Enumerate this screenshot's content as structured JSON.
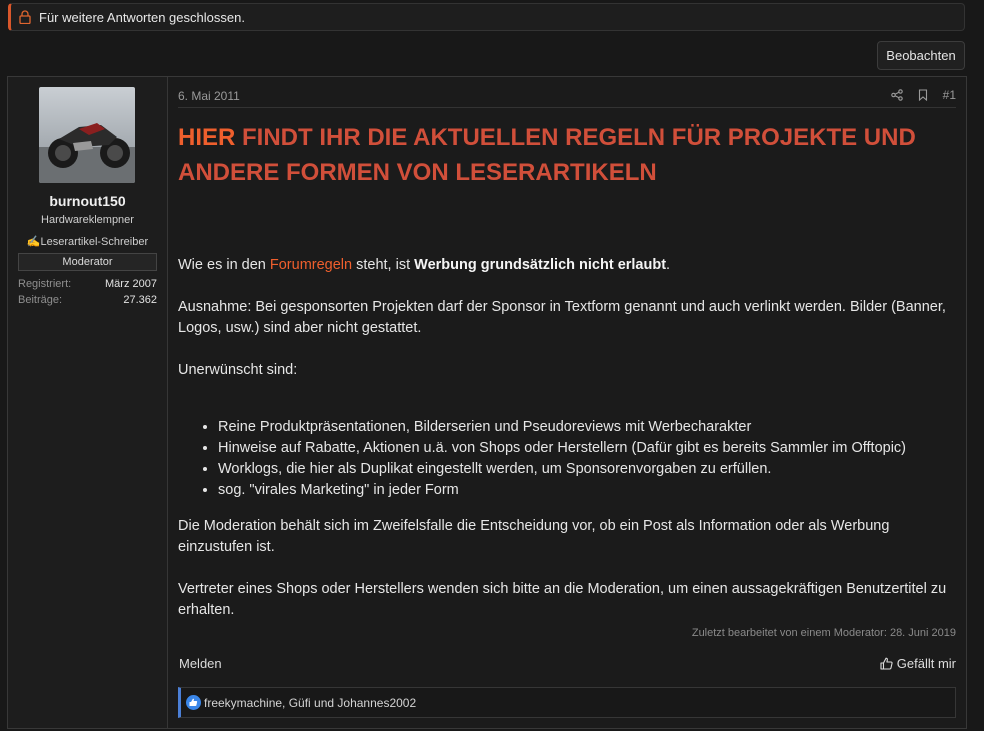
{
  "notice": {
    "text": "Für weitere Antworten geschlossen."
  },
  "watch_button": "Beobachten",
  "user": {
    "name": "burnout150",
    "title": "Hardwareklempner",
    "badge": "✍️Leserartikel-Schreiber",
    "banner": "Moderator",
    "stats": [
      {
        "key": "Registriert:",
        "value": "März 2007"
      },
      {
        "key": "Beiträge:",
        "value": "27.362"
      }
    ]
  },
  "post": {
    "date": "6. Mai 2011",
    "number": "#1",
    "headline_highlight": "HIER",
    "headline_rest": " FINDT IHR DIE AKTUELLEN REGELN FÜR PROJEKTE UND ANDERE FORMEN VON LESERARTIKELN",
    "p1_prefix": "Wie es in den ",
    "p1_link": "Forumregeln",
    "p1_middle": " steht, ist ",
    "p1_bold": "Werbung grundsätzlich nicht erlaubt",
    "p1_suffix": ".",
    "p2": "Ausnahme: Bei gesponsorten Projekten darf der Sponsor in Textform genannt und auch verlinkt werden. Bilder (Banner, Logos, usw.) sind aber nicht gestattet.",
    "p3": "Unerwünscht sind:",
    "list": [
      "Reine Produktpräsentationen, Bilderserien und Pseudoreviews mit Werbecharakter",
      "Hinweise auf Rabatte, Aktionen u.ä. von Shops oder Herstellern (Dafür gibt es bereits Sammler im Offtopic)",
      "Worklogs, die hier als Duplikat eingestellt werden, um Sponsorenvorgaben zu erfüllen.",
      "sog. \"virales Marketing\" in jeder Form"
    ],
    "p4": "Die Moderation behält sich im Zweifelsfalle die Entscheidung vor, ob ein Post als Information oder als Werbung einzustufen ist.",
    "p5": "Vertreter eines Shops oder Herstellers wenden sich bitte an die Moderation, um einen aussagekräftigen Benutzertitel zu erhalten.",
    "edited": "Zuletzt bearbeitet von einem Moderator: 28. Juni 2019",
    "report": "Melden",
    "like": "Gefällt mir",
    "reactions": "freekymachine, Güfi und Johannes2002"
  },
  "colors": {
    "accent": "#ef5f2d",
    "headline": "#d14f3a",
    "reaction_bar": "#4b7fd6"
  }
}
